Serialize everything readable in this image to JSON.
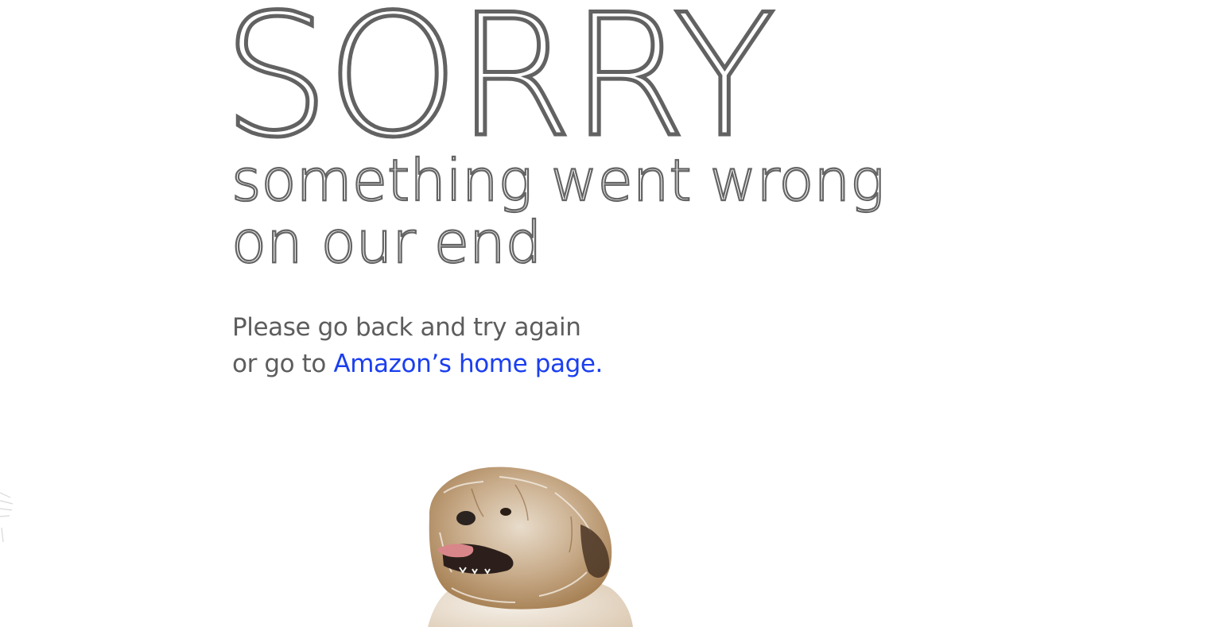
{
  "error": {
    "headline": "SORRY",
    "subheading": {
      "line1": "something went wrong",
      "line2": "on our end"
    },
    "message": {
      "line1": "Please go back and try again",
      "line2_prefix": "or go to ",
      "home_link": "Amazon’s home page."
    }
  },
  "colors": {
    "heading_text": "#646464",
    "body_text": "#5d5d5d",
    "link": "#1a3ff0",
    "background": "#ffffff"
  },
  "images": {
    "dog": "dog-photo"
  }
}
